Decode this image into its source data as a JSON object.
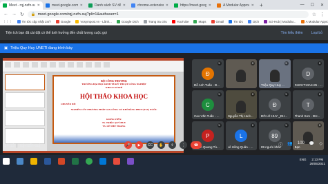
{
  "browser": {
    "tabs": [
      {
        "title": "Meet - rqj-nzfn-suj",
        "active": true,
        "color": "#00ac47"
      },
      {
        "title": "meet.google.com/rqj-nz",
        "active": false,
        "color": "#1a73e8"
      },
      {
        "title": "Danh sách SV đăng ký tham dự",
        "active": false,
        "color": "#0f9d58"
      },
      {
        "title": "chrome-extension://appottele",
        "active": false,
        "color": "#4285f4"
      },
      {
        "title": "https://meet.google.com/rqj",
        "active": false,
        "color": "#00ac47"
      },
      {
        "title": "A Modular Approach",
        "active": false,
        "color": "#e8710a"
      }
    ],
    "new_tab": "+",
    "url": "meet.google.com/rqj-nzfn-suj?pli=1&authuser=1",
    "bookmarks": [
      "Tin tức cập nhật 24/7",
      "Google",
      "Vosymposi.vn - Lânh...",
      "Google Dịch",
      "Trang tra cứu",
      "YouTube",
      "Maps",
      "Gmail",
      "Tin tức",
      "Dịch",
      "Sci-Hub | Modular...",
      "A Modular Approac..."
    ]
  },
  "banner": {
    "text": "Tiện ích bạn đã cài đặt có thể ảnh hưởng đến chất lượng cuộc gọi",
    "learn_more": "Tìm hiểu thêm",
    "dismiss": "Loại bỏ"
  },
  "presentation": {
    "text": "Triệu Quy Huy UNETI đang trình bày"
  },
  "slide": {
    "lines": [
      "BỘ CÔNG THƯƠNG",
      "TRƯỜNG ĐẠI HỌC KINH TẾ-KỸ THUẬT CÔNG NGHIỆP",
      "KHOA CƠ KHÍ",
      "HỘI THẢO KHOA HỌC",
      "CHUYÊN ĐỀ:",
      "NGHIÊN CỨU PHƯƠNG PHÁP GIA CÔNG CƠ KHÍ BẰNG PHUN (TIA) NƯỚC",
      "GIẢNG VIÊN:",
      "TS. TRIỆU QUÝ HUY",
      "TS. LÊ NHƯ TRANG"
    ]
  },
  "participants": [
    {
      "name": "Đỗ Anh Tuấn - Đ...",
      "initial": "Đ",
      "color": "#e37400",
      "video": false
    },
    {
      "name": "",
      "initial": "",
      "color": "",
      "video": true,
      "variant": "a"
    },
    {
      "name": "Triệu Quy Huy ...",
      "initial": "",
      "color": "",
      "video": true,
      "variant": "b"
    },
    {
      "name": "DHCKT13A1HN - ...",
      "initial": "D",
      "color": "#5f6368",
      "video": false
    },
    {
      "name": "Cao Văn Tuấn - ...",
      "initial": "C",
      "color": "#1e8e3e",
      "video": false
    },
    {
      "name": "Nguyễn Thị Hườ...",
      "initial": "",
      "color": "",
      "video": true,
      "variant": "c"
    },
    {
      "name": "ĐỖ LÊ HUY _ĐH...",
      "initial": "Đ",
      "color": "#5f6368",
      "video": false
    },
    {
      "name": "Thanh Sơn - ĐH...",
      "initial": "T",
      "color": "#5f6368",
      "video": false
    },
    {
      "name": "Phạm Quang Tù...",
      "initial": "P",
      "color": "#c5221f",
      "video": false
    },
    {
      "name": "Lê Hồng Quân - ...",
      "initial": "L",
      "color": "#1a73e8",
      "video": false
    },
    {
      "name": "89 người khác",
      "initial": "89",
      "color": "#5f6368",
      "video": false
    },
    {
      "name": "Bạn",
      "initial": "",
      "color": "",
      "video": true,
      "variant": "a"
    }
  ],
  "meeting": {
    "time": "14:13",
    "separator": "|",
    "code": "rqj-nzfn-suj",
    "participant_count": "100"
  },
  "taskbar": {
    "clock_time": "2:13 PM",
    "clock_date": "26/05/2021",
    "lang": "ENG"
  }
}
